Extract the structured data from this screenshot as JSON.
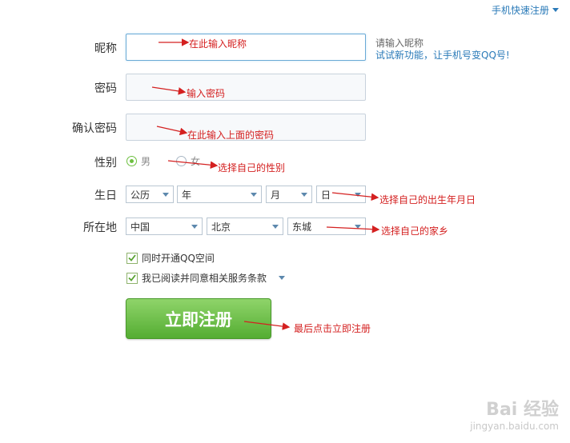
{
  "header": {
    "quick_register": "手机快速注册"
  },
  "form": {
    "nickname_label": "昵称",
    "nickname_hint": "请输入昵称",
    "nickname_tip_link": "试试新功能，让手机号变QQ号!",
    "password_label": "密码",
    "confirm_label": "确认密码",
    "gender_label": "性别",
    "gender_options": [
      "男",
      "女"
    ],
    "gender_selected": "男",
    "birthday_label": "生日",
    "birthday": {
      "calendar": "公历",
      "year": "年",
      "month": "月",
      "day": "日"
    },
    "location_label": "所在地",
    "location": {
      "country": "中国",
      "province": "北京",
      "city": "东城"
    },
    "open_qzone": "同时开通QQ空间",
    "agree_terms": "我已阅读并同意相关服务条款",
    "submit": "立即注册"
  },
  "annotations": {
    "nickname": "在此输入昵称",
    "password": "输入密码",
    "confirm": "在此输入上面的密码",
    "gender": "选择自己的性别",
    "birthday": "选择自己的出生年月日",
    "location": "选择自己的家乡",
    "submit": "最后点击立即注册"
  },
  "watermark": {
    "logo": "Bai 经验",
    "url": "jingyan.baidu.com"
  },
  "colors": {
    "accent": "#2a7ab8",
    "button": "#54ad32",
    "annotation": "#d42020"
  }
}
